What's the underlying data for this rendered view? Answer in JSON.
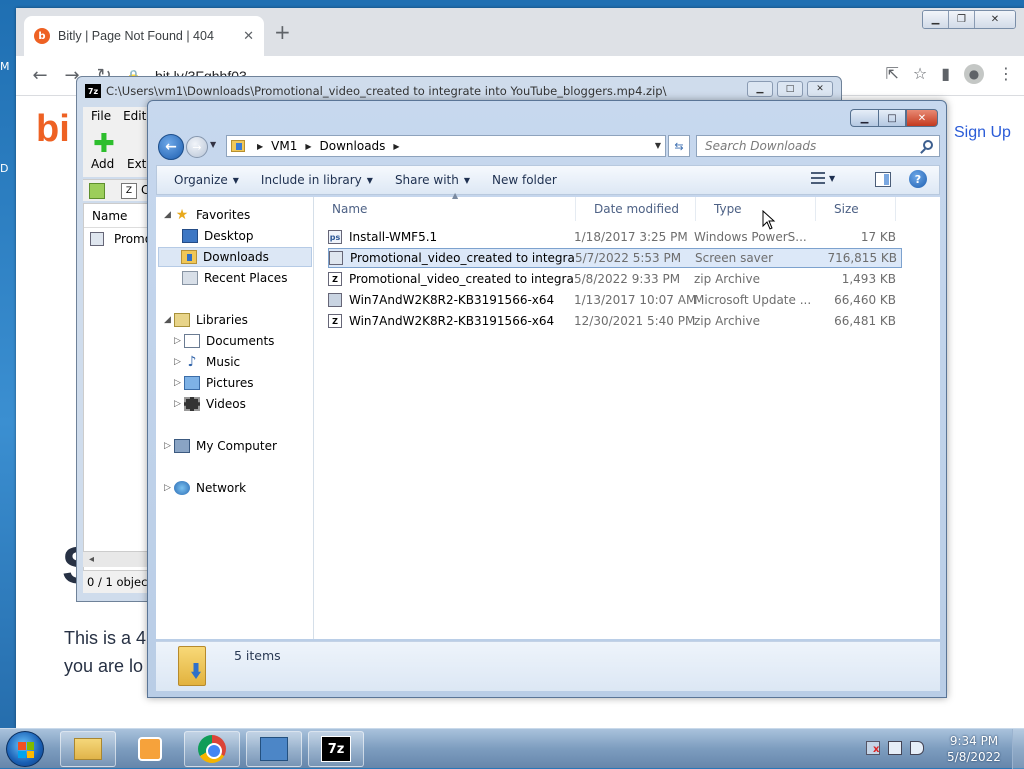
{
  "desktop": {
    "edge_letters": [
      "M",
      "D"
    ]
  },
  "browser": {
    "tab_title": "Bitly | Page Not Found | 404",
    "url": "bit.ly/3Fghhf03",
    "logo_text": "bi",
    "signup": "Sign Up",
    "heading_fragment": "S",
    "text_line1": "This is a 4",
    "text_line2": "you are lo"
  },
  "sevenzip": {
    "title": "C:\\Users\\vm1\\Downloads\\Promotional_video_created to integrate into YouTube_bloggers.mp4.zip\\",
    "menu": [
      "File",
      "Edit"
    ],
    "toolbar": {
      "add": "Add",
      "extract": "Extr"
    },
    "path_fragment": "C",
    "list_header": "Name",
    "list_row": "Promot",
    "status": "0 / 1 object(s)"
  },
  "explorer": {
    "breadcrumb": [
      "VM1",
      "Downloads"
    ],
    "search_placeholder": "Search Downloads",
    "commands": [
      "Organize",
      "Include in library",
      "Share with",
      "New folder"
    ],
    "nav": {
      "favorites": {
        "label": "Favorites",
        "items": [
          "Desktop",
          "Downloads",
          "Recent Places"
        ]
      },
      "libraries": {
        "label": "Libraries",
        "items": [
          "Documents",
          "Music",
          "Pictures",
          "Videos"
        ]
      },
      "computer": "My Computer",
      "network": "Network"
    },
    "columns": [
      "Name",
      "Date modified",
      "Type",
      "Size"
    ],
    "files": [
      {
        "name": "Install-WMF5.1",
        "date": "1/18/2017 3:25 PM",
        "type": "Windows PowerS...",
        "size": "17 KB",
        "icon": "powershell-icon"
      },
      {
        "name": "Promotional_video_created to integrate i...",
        "date": "5/7/2022 5:53 PM",
        "type": "Screen saver",
        "size": "716,815 KB",
        "icon": "screensaver-icon"
      },
      {
        "name": "Promotional_video_created to integrate i...",
        "date": "5/8/2022 9:33 PM",
        "type": "zip Archive",
        "size": "1,493 KB",
        "icon": "zip-icon"
      },
      {
        "name": "Win7AndW2K8R2-KB3191566-x64",
        "date": "1/13/2017 10:07 AM",
        "type": "Microsoft Update ...",
        "size": "66,460 KB",
        "icon": "update-package-icon"
      },
      {
        "name": "Win7AndW2K8R2-KB3191566-x64",
        "date": "12/30/2021 5:40 PM",
        "type": "zip Archive",
        "size": "66,481 KB",
        "icon": "zip-icon"
      }
    ],
    "item_count": "5 items"
  },
  "taskbar": {
    "time": "9:34 PM",
    "date": "5/8/2022",
    "sevenzip_label": "7z"
  }
}
